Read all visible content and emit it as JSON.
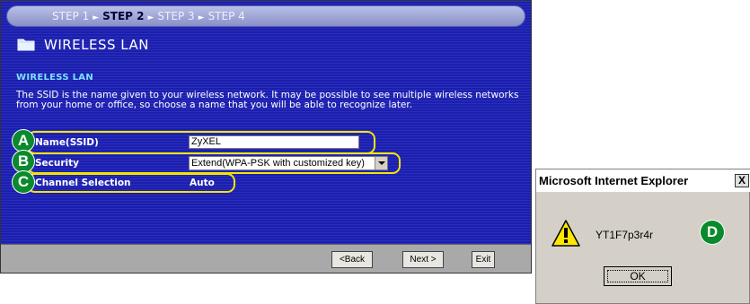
{
  "wizard": {
    "steps": [
      {
        "label": "STEP 1",
        "active": false
      },
      {
        "label": "STEP 2",
        "active": true
      },
      {
        "label": "STEP 3",
        "active": false
      },
      {
        "label": "STEP 4",
        "active": false
      }
    ],
    "header_title": "WIRELESS LAN",
    "section_title": "WIRELESS LAN",
    "description": "The SSID is the name given to your wireless network. It may be possible to see multiple wireless networks from your home or office, so choose a name that you will be able to recognize later.",
    "fields": {
      "ssid": {
        "label": "Name(SSID)",
        "value": "ZyXEL"
      },
      "security": {
        "label": "Security",
        "value": "Extend(WPA-PSK with customized key)"
      },
      "channel": {
        "label": "Channel Selection",
        "value": "Auto"
      }
    },
    "buttons": {
      "back": "<Back",
      "next": "Next >",
      "exit": "Exit"
    }
  },
  "callouts": {
    "a": "A",
    "b": "B",
    "c": "C",
    "d": "D"
  },
  "dialog": {
    "title": "Microsoft Internet Explorer",
    "close": "X",
    "message": "YT1F7p3r4r",
    "ok_label": "OK",
    "icon": "warning-icon"
  },
  "colors": {
    "panel_bg": "#1b1fb0",
    "highlight": "#f5e600",
    "callout_badge": "#0a8a2c",
    "section_title": "#7ee0ff"
  }
}
